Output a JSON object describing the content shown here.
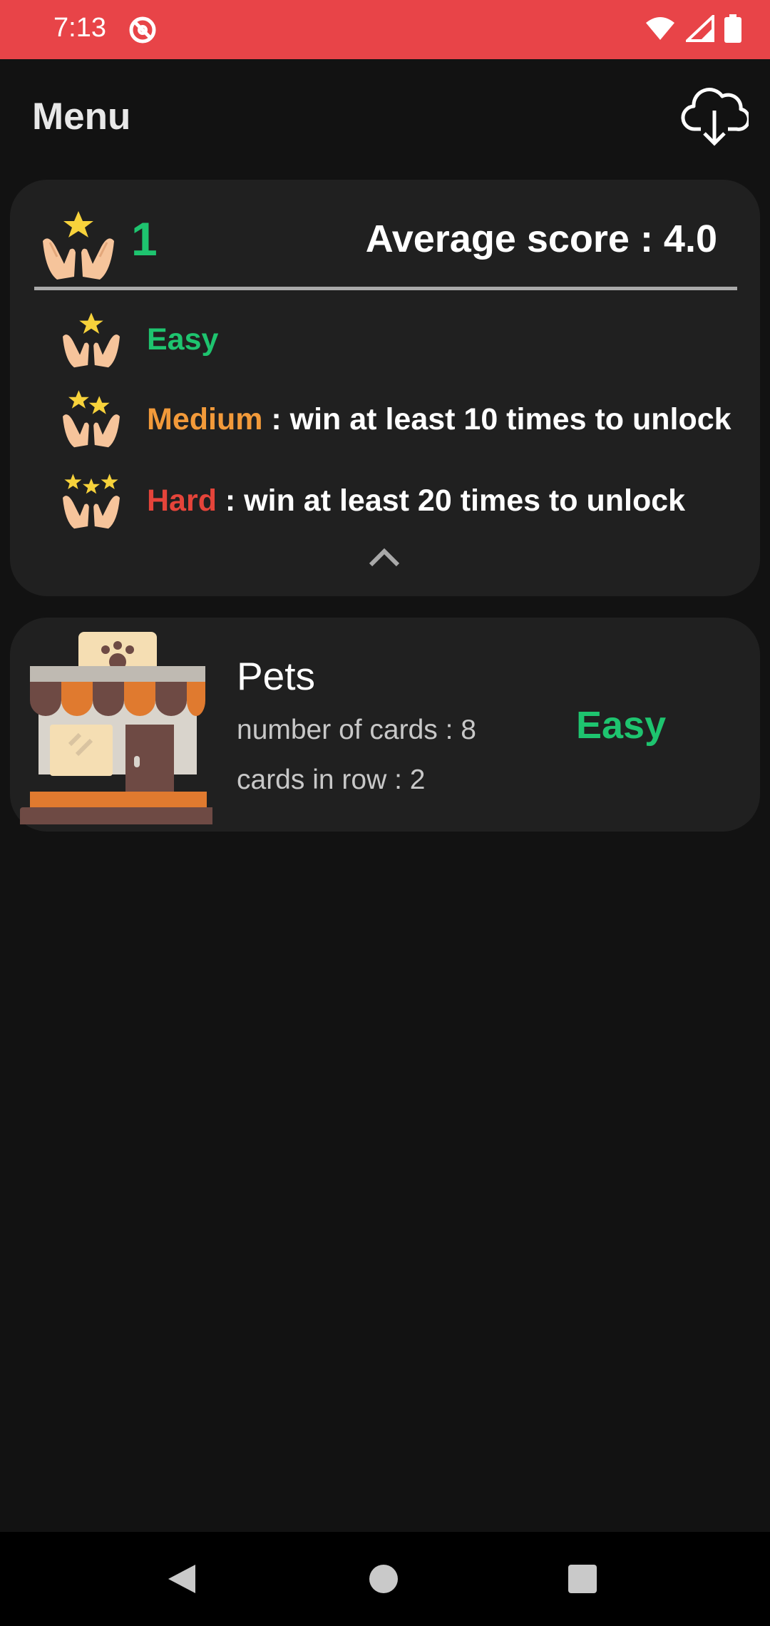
{
  "status_bar": {
    "time": "7:13",
    "bg_color": "#e84448"
  },
  "app_bar": {
    "title": "Menu",
    "action_icon": "cloud-download-icon"
  },
  "score_card": {
    "wins": "1",
    "average_score": "Average score : 4.0",
    "levels": [
      {
        "name": "Easy",
        "detail": "",
        "stars": 1,
        "color": "#1ec46f"
      },
      {
        "name": "Medium",
        "detail": " : win at least 10 times to unlock",
        "stars": 2,
        "color": "#f29a3a"
      },
      {
        "name": "Hard",
        "detail": " : win at least 20 times to unlock",
        "stars": 3,
        "color": "#e5443a"
      }
    ],
    "collapse_icon": "chevron-up-icon"
  },
  "deck": {
    "title": "Pets",
    "cards_count": "number of cards : 8",
    "cards_in_row": "cards in row : 2",
    "level": "Easy",
    "image_icon": "pet-shop-icon"
  },
  "colors": {
    "background": "#121212",
    "card": "#202020",
    "accent_green": "#1ec46f"
  }
}
